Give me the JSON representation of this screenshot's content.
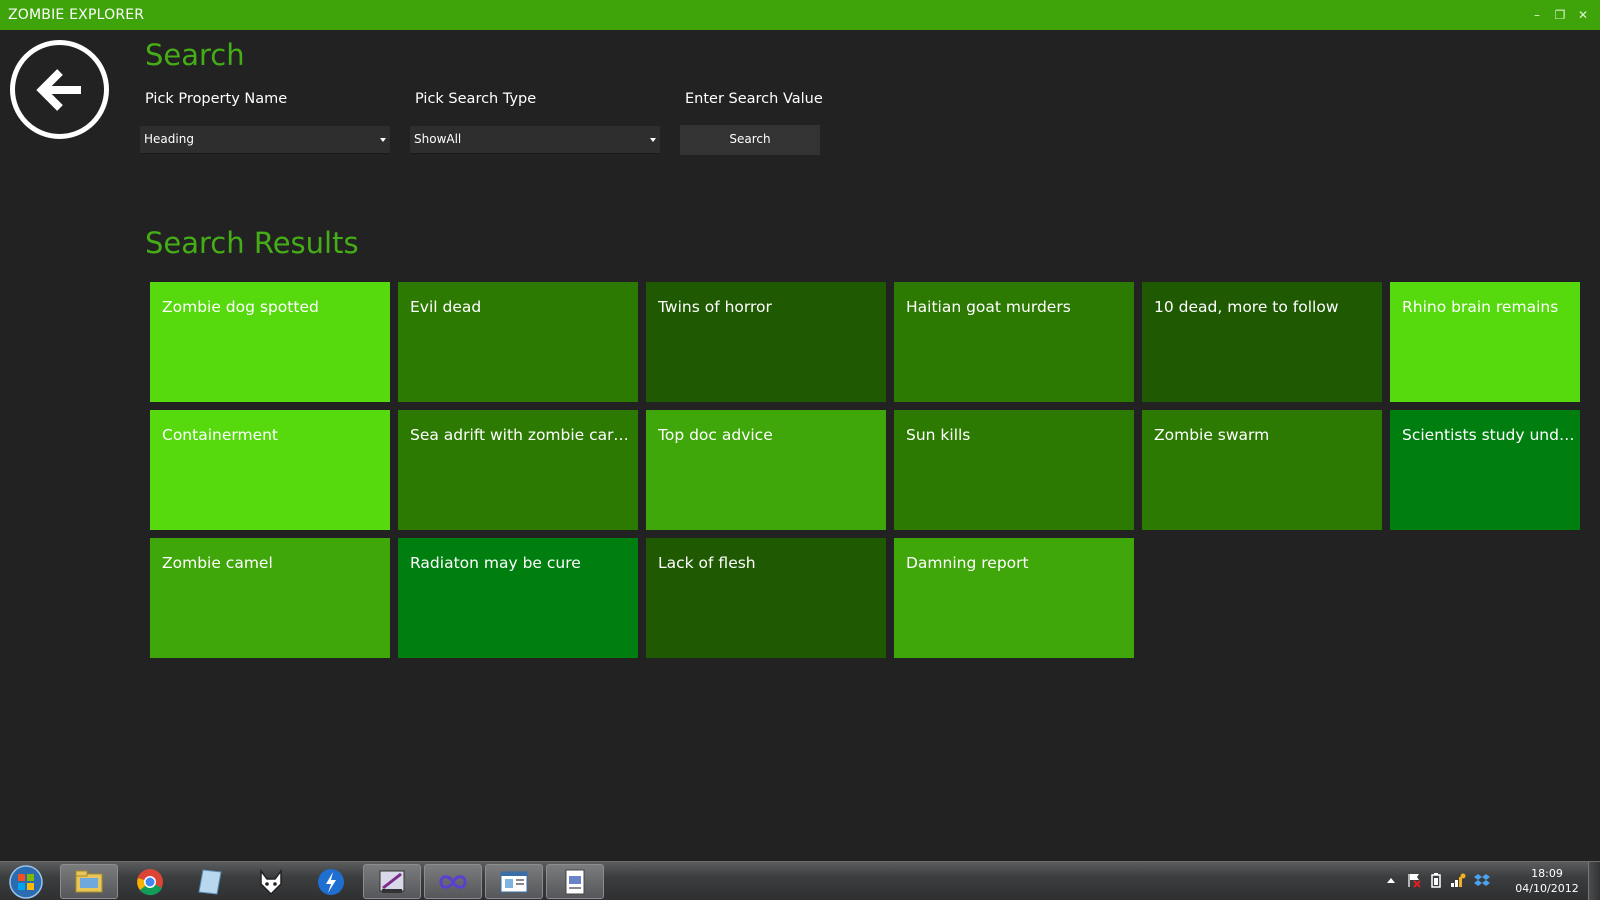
{
  "window": {
    "title": "ZOMBIE EXPLORER",
    "controls": {
      "minimize": "–",
      "restore": "❐",
      "close": "✕"
    }
  },
  "colors": {
    "titlebar": "#3fa30a",
    "background": "#222222",
    "accent_text": "#45ad16",
    "tile_bright": "#56d90d",
    "tile_light": "#3fa70a",
    "tile_medium": "#2d7a03",
    "tile_dark": "#1f5902",
    "tile_emerald": "#007f10"
  },
  "search": {
    "heading": "Search",
    "property_label": "Pick Property Name",
    "type_label": "Pick Search Type",
    "value_label": "Enter Search Value",
    "property_value": "Heading",
    "type_value": "ShowAll",
    "button_label": "Search"
  },
  "results": {
    "heading": "Search Results",
    "tiles": [
      {
        "label": "Zombie dog spotted",
        "shade": "bright"
      },
      {
        "label": "Evil dead",
        "shade": "medium"
      },
      {
        "label": "Twins of horror",
        "shade": "dark"
      },
      {
        "label": "Haitian goat murders",
        "shade": "medium"
      },
      {
        "label": "10 dead, more to follow",
        "shade": "dark"
      },
      {
        "label": "Rhino brain remains",
        "shade": "bright"
      },
      {
        "label": "Containerment",
        "shade": "bright"
      },
      {
        "label": "Sea adrift with zombie carcas...",
        "shade": "medium"
      },
      {
        "label": "Top doc advice",
        "shade": "light"
      },
      {
        "label": "Sun kills",
        "shade": "medium"
      },
      {
        "label": "Zombie swarm",
        "shade": "medium"
      },
      {
        "label": "Scientists study undead",
        "shade": "emerald"
      },
      {
        "label": "Zombie camel",
        "shade": "light"
      },
      {
        "label": "Radiaton may be cure",
        "shade": "emerald"
      },
      {
        "label": "Lack of flesh",
        "shade": "dark"
      },
      {
        "label": "Damning report",
        "shade": "light"
      }
    ]
  },
  "taskbar": {
    "apps": [
      "windows-explorer",
      "chrome",
      "notepad-plus",
      "foxit",
      "lightning",
      "visual-studio",
      "infinity",
      "window-app",
      "document-app"
    ],
    "clock_time": "18:09",
    "clock_date": "04/10/2012"
  }
}
